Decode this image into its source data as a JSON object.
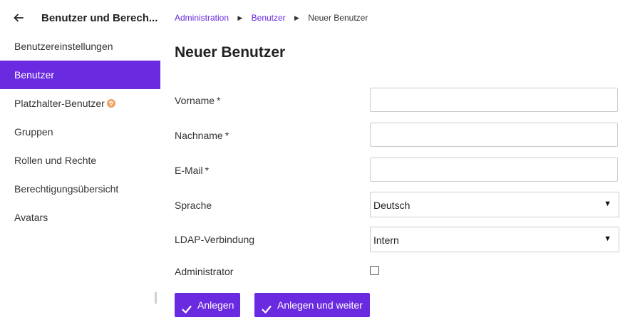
{
  "sidebar": {
    "title": "Benutzer und Berech...",
    "back_icon": "arrow-left-icon",
    "items": [
      {
        "label": "Benutzereinstellungen",
        "active": false
      },
      {
        "label": "Benutzer",
        "active": true
      },
      {
        "label": "Platzhalter-Benutzer",
        "active": false,
        "badge": "enterprise-badge-icon"
      },
      {
        "label": "Gruppen",
        "active": false
      },
      {
        "label": "Rollen und Rechte",
        "active": false
      },
      {
        "label": "Berechtigungsübersicht",
        "active": false
      },
      {
        "label": "Avatars",
        "active": false
      }
    ]
  },
  "breadcrumb": {
    "items": [
      "Administration",
      "Benutzer"
    ],
    "current": "Neuer Benutzer",
    "separator_icon": "caret-right-icon"
  },
  "page_title": "Neuer Benutzer",
  "form": {
    "required_marker": "*",
    "firstname": {
      "label": "Vorname",
      "value": "",
      "placeholder": ""
    },
    "lastname": {
      "label": "Nachname",
      "value": "",
      "placeholder": ""
    },
    "email": {
      "label": "E-Mail",
      "value": "",
      "placeholder": ""
    },
    "language": {
      "label": "Sprache",
      "selected": "Deutsch"
    },
    "ldap": {
      "label": "LDAP-Verbindung",
      "selected": "Intern"
    },
    "admin": {
      "label": "Administrator",
      "checked": false
    },
    "caret_glyph": "▼"
  },
  "buttons": {
    "create": "Anlegen",
    "create_continue": "Anlegen und weiter",
    "icon": "checkmark-icon"
  },
  "colors": {
    "accent": "#6a2ae0",
    "badge": "#f0a060"
  }
}
